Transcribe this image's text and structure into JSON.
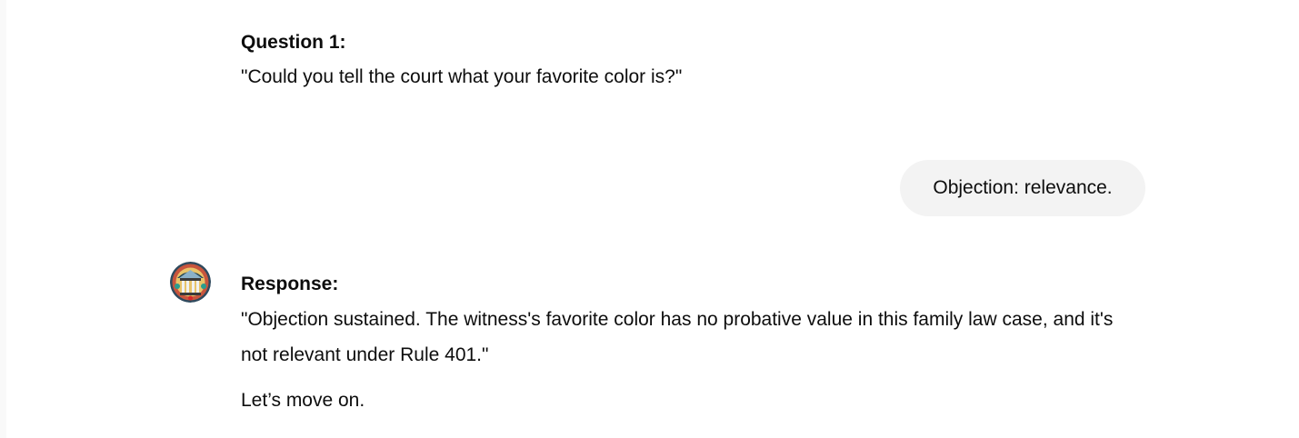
{
  "conversation": {
    "assistant_prev": {
      "heading": "Question 1:",
      "body": "\"Could you tell the court what your favorite color is?\""
    },
    "user_message": {
      "text": "Objection: relevance."
    },
    "assistant_reply": {
      "avatar_icon": "courthouse-avatar-icon",
      "heading": "Response:",
      "body": "\"Objection sustained. The witness's favorite color has no probative value in this family law case, and it's not relevant under Rule 401.\"",
      "closing": "Let’s move on."
    }
  },
  "colors": {
    "background": "#ffffff",
    "text": "#0d0d0d",
    "user_bubble": "#f3f3f3"
  }
}
